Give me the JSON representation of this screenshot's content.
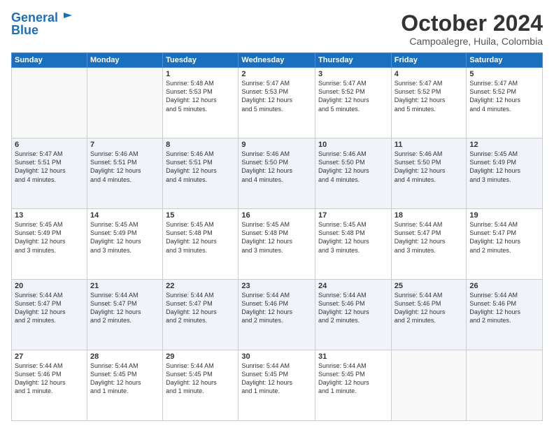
{
  "logo": {
    "line1": "General",
    "line2": "Blue"
  },
  "title": "October 2024",
  "subtitle": "Campoalegre, Huila, Colombia",
  "days_of_week": [
    "Sunday",
    "Monday",
    "Tuesday",
    "Wednesday",
    "Thursday",
    "Friday",
    "Saturday"
  ],
  "weeks": [
    [
      {
        "day": "",
        "sunrise": "",
        "sunset": "",
        "daylight": ""
      },
      {
        "day": "",
        "sunrise": "",
        "sunset": "",
        "daylight": ""
      },
      {
        "day": "1",
        "sunrise": "Sunrise: 5:48 AM",
        "sunset": "Sunset: 5:53 PM",
        "daylight": "Daylight: 12 hours and 5 minutes."
      },
      {
        "day": "2",
        "sunrise": "Sunrise: 5:47 AM",
        "sunset": "Sunset: 5:53 PM",
        "daylight": "Daylight: 12 hours and 5 minutes."
      },
      {
        "day": "3",
        "sunrise": "Sunrise: 5:47 AM",
        "sunset": "Sunset: 5:52 PM",
        "daylight": "Daylight: 12 hours and 5 minutes."
      },
      {
        "day": "4",
        "sunrise": "Sunrise: 5:47 AM",
        "sunset": "Sunset: 5:52 PM",
        "daylight": "Daylight: 12 hours and 5 minutes."
      },
      {
        "day": "5",
        "sunrise": "Sunrise: 5:47 AM",
        "sunset": "Sunset: 5:52 PM",
        "daylight": "Daylight: 12 hours and 4 minutes."
      }
    ],
    [
      {
        "day": "6",
        "sunrise": "Sunrise: 5:47 AM",
        "sunset": "Sunset: 5:51 PM",
        "daylight": "Daylight: 12 hours and 4 minutes."
      },
      {
        "day": "7",
        "sunrise": "Sunrise: 5:46 AM",
        "sunset": "Sunset: 5:51 PM",
        "daylight": "Daylight: 12 hours and 4 minutes."
      },
      {
        "day": "8",
        "sunrise": "Sunrise: 5:46 AM",
        "sunset": "Sunset: 5:51 PM",
        "daylight": "Daylight: 12 hours and 4 minutes."
      },
      {
        "day": "9",
        "sunrise": "Sunrise: 5:46 AM",
        "sunset": "Sunset: 5:50 PM",
        "daylight": "Daylight: 12 hours and 4 minutes."
      },
      {
        "day": "10",
        "sunrise": "Sunrise: 5:46 AM",
        "sunset": "Sunset: 5:50 PM",
        "daylight": "Daylight: 12 hours and 4 minutes."
      },
      {
        "day": "11",
        "sunrise": "Sunrise: 5:46 AM",
        "sunset": "Sunset: 5:50 PM",
        "daylight": "Daylight: 12 hours and 4 minutes."
      },
      {
        "day": "12",
        "sunrise": "Sunrise: 5:45 AM",
        "sunset": "Sunset: 5:49 PM",
        "daylight": "Daylight: 12 hours and 3 minutes."
      }
    ],
    [
      {
        "day": "13",
        "sunrise": "Sunrise: 5:45 AM",
        "sunset": "Sunset: 5:49 PM",
        "daylight": "Daylight: 12 hours and 3 minutes."
      },
      {
        "day": "14",
        "sunrise": "Sunrise: 5:45 AM",
        "sunset": "Sunset: 5:49 PM",
        "daylight": "Daylight: 12 hours and 3 minutes."
      },
      {
        "day": "15",
        "sunrise": "Sunrise: 5:45 AM",
        "sunset": "Sunset: 5:48 PM",
        "daylight": "Daylight: 12 hours and 3 minutes."
      },
      {
        "day": "16",
        "sunrise": "Sunrise: 5:45 AM",
        "sunset": "Sunset: 5:48 PM",
        "daylight": "Daylight: 12 hours and 3 minutes."
      },
      {
        "day": "17",
        "sunrise": "Sunrise: 5:45 AM",
        "sunset": "Sunset: 5:48 PM",
        "daylight": "Daylight: 12 hours and 3 minutes."
      },
      {
        "day": "18",
        "sunrise": "Sunrise: 5:44 AM",
        "sunset": "Sunset: 5:47 PM",
        "daylight": "Daylight: 12 hours and 3 minutes."
      },
      {
        "day": "19",
        "sunrise": "Sunrise: 5:44 AM",
        "sunset": "Sunset: 5:47 PM",
        "daylight": "Daylight: 12 hours and 2 minutes."
      }
    ],
    [
      {
        "day": "20",
        "sunrise": "Sunrise: 5:44 AM",
        "sunset": "Sunset: 5:47 PM",
        "daylight": "Daylight: 12 hours and 2 minutes."
      },
      {
        "day": "21",
        "sunrise": "Sunrise: 5:44 AM",
        "sunset": "Sunset: 5:47 PM",
        "daylight": "Daylight: 12 hours and 2 minutes."
      },
      {
        "day": "22",
        "sunrise": "Sunrise: 5:44 AM",
        "sunset": "Sunset: 5:47 PM",
        "daylight": "Daylight: 12 hours and 2 minutes."
      },
      {
        "day": "23",
        "sunrise": "Sunrise: 5:44 AM",
        "sunset": "Sunset: 5:46 PM",
        "daylight": "Daylight: 12 hours and 2 minutes."
      },
      {
        "day": "24",
        "sunrise": "Sunrise: 5:44 AM",
        "sunset": "Sunset: 5:46 PM",
        "daylight": "Daylight: 12 hours and 2 minutes."
      },
      {
        "day": "25",
        "sunrise": "Sunrise: 5:44 AM",
        "sunset": "Sunset: 5:46 PM",
        "daylight": "Daylight: 12 hours and 2 minutes."
      },
      {
        "day": "26",
        "sunrise": "Sunrise: 5:44 AM",
        "sunset": "Sunset: 5:46 PM",
        "daylight": "Daylight: 12 hours and 2 minutes."
      }
    ],
    [
      {
        "day": "27",
        "sunrise": "Sunrise: 5:44 AM",
        "sunset": "Sunset: 5:46 PM",
        "daylight": "Daylight: 12 hours and 1 minute."
      },
      {
        "day": "28",
        "sunrise": "Sunrise: 5:44 AM",
        "sunset": "Sunset: 5:45 PM",
        "daylight": "Daylight: 12 hours and 1 minute."
      },
      {
        "day": "29",
        "sunrise": "Sunrise: 5:44 AM",
        "sunset": "Sunset: 5:45 PM",
        "daylight": "Daylight: 12 hours and 1 minute."
      },
      {
        "day": "30",
        "sunrise": "Sunrise: 5:44 AM",
        "sunset": "Sunset: 5:45 PM",
        "daylight": "Daylight: 12 hours and 1 minute."
      },
      {
        "day": "31",
        "sunrise": "Sunrise: 5:44 AM",
        "sunset": "Sunset: 5:45 PM",
        "daylight": "Daylight: 12 hours and 1 minute."
      },
      {
        "day": "",
        "sunrise": "",
        "sunset": "",
        "daylight": ""
      },
      {
        "day": "",
        "sunrise": "",
        "sunset": "",
        "daylight": ""
      }
    ]
  ]
}
